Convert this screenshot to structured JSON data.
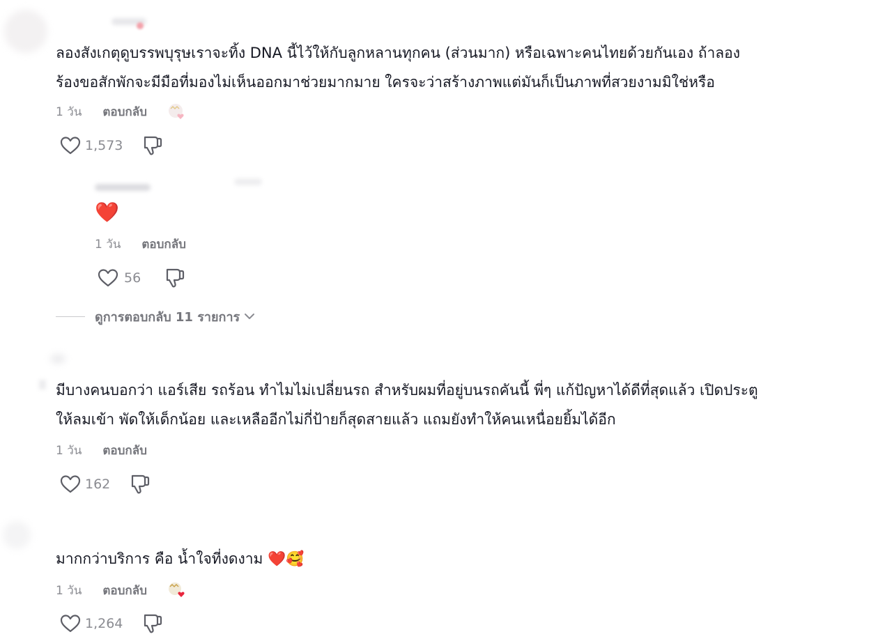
{
  "comments": [
    {
      "lines": [
        "ลองสังเกตุดูบรรพบุรุษเราจะทิ้ง DNA นี้ไว้ให้กับลูกหลานทุกคน (ส่วนมาก) หรือเฉพาะคนไทยด้วยกันเอง ถ้าลอง",
        "ร้องขอสักพักจะมีมือที่มองไม่เห็นออกมาช่วยมากมาย ใครจะว่าสร้างภาพแต่มันก็เป็นภาพที่สวยงามมิใช่หรือ"
      ],
      "time": "1 วัน",
      "reply_label": "ตอบกลับ",
      "likes": "1,573"
    },
    {
      "emoji": "❤️",
      "time": "1 วัน",
      "reply_label": "ตอบกลับ",
      "likes": "56"
    },
    {
      "lines": [
        "มีบางคนบอกว่า แอร์เสีย รถร้อน ทำไมไม่เปลี่ยนรถ สำหรับผมที่อยู่บนรถคันนี้ พี่ๆ แก้ปัญหาได้ดีที่สุดแล้ว เปิดประตู",
        "ให้ลมเข้า พัดให้เด็กน้อย และเหลืออีกไม่กี่ป้ายก็สุดสายแล้ว แถมยังทำให้คนเหนื่อยยิ้มได้อีก"
      ],
      "time": "1 วัน",
      "reply_label": "ตอบกลับ",
      "likes": "162"
    },
    {
      "text": "มากกว่าบริการ คือ น้ำใจที่งดงาม ❤️🥰",
      "time": "1 วัน",
      "reply_label": "ตอบกลับ",
      "likes": "1,264"
    }
  ],
  "view_replies": "ดูการตอบกลับ 11 รายการ",
  "icons": {
    "like": "heart-outline-icon",
    "dislike": "thumbs-down-icon",
    "expand": "chevron-down-icon",
    "creator_badge": "liked-by-creator-icon"
  },
  "colors": {
    "text": "#161823",
    "muted": "#8a8b91",
    "heart": "#e8263d"
  }
}
